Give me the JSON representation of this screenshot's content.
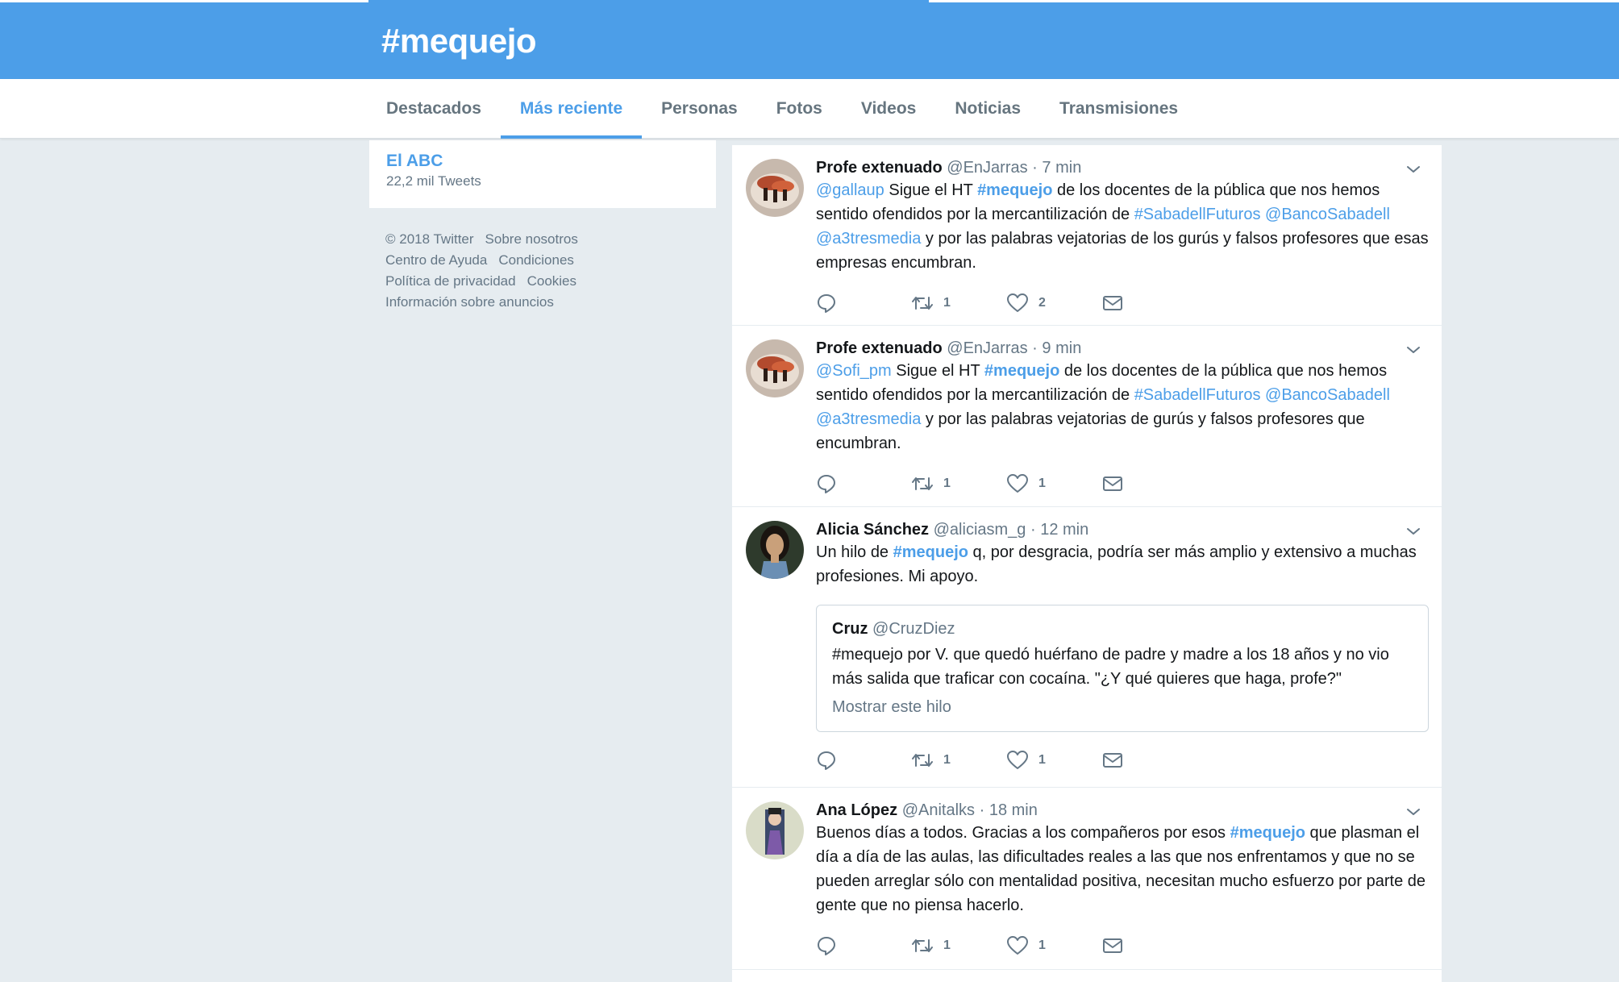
{
  "header": {
    "title": "#mequejo"
  },
  "tabs": [
    {
      "label": "Destacados"
    },
    {
      "label": "Más reciente"
    },
    {
      "label": "Personas"
    },
    {
      "label": "Fotos"
    },
    {
      "label": "Videos"
    },
    {
      "label": "Noticias"
    },
    {
      "label": "Transmisiones"
    }
  ],
  "active_tab": "Más reciente",
  "trend": {
    "name": "El ABC",
    "count": "22,2 mil Tweets"
  },
  "footer": {
    "row1": [
      "© 2018 Twitter",
      "Sobre nosotros"
    ],
    "row2": [
      "Centro de Ayuda",
      "Condiciones"
    ],
    "row3": [
      "Política de privacidad",
      "Cookies"
    ],
    "row4": [
      "Información sobre anuncios"
    ]
  },
  "tweets": [
    {
      "name": "Profe extenuado",
      "handle": "@EnJarras",
      "sep": "·",
      "time": "7 min",
      "text": {
        "t1": "@gallaup",
        "t2": " Sigue el HT ",
        "t3": "#mequejo",
        "t4": " de los docentes de la pública que nos hemos sentido ofendidos por la mercantilización de ",
        "t5": "#SabadellFuturos",
        "t6": " ",
        "t7": "@BancoSabadell",
        "t8": " ",
        "t9": "@a3tresmedia",
        "t10": " y por las palabras vejatorias de los gurús y falsos profesores que esas empresas encumbran."
      },
      "retweets": "1",
      "likes": "2"
    },
    {
      "name": "Profe extenuado",
      "handle": "@EnJarras",
      "sep": "·",
      "time": "9 min",
      "text": {
        "t1": "@Sofi_pm",
        "t2": " Sigue el HT ",
        "t3": "#mequejo",
        "t4": " de los docentes de la pública que nos hemos sentido ofendidos por la mercantilización de ",
        "t5": "#SabadellFuturos",
        "t6": " ",
        "t7": "@BancoSabadell",
        "t8": " ",
        "t9": "@a3tresmedia",
        "t10": " y por las palabras vejatorias de gurús y falsos profesores que encumbran."
      },
      "retweets": "1",
      "likes": "1"
    },
    {
      "name": "Alicia Sánchez",
      "handle": "@aliciasm_g",
      "sep": "·",
      "time": "12 min",
      "text": {
        "t1": "Un hilo de ",
        "t2": "#mequejo",
        "t3": " q, por desgracia, podría ser más amplio y extensivo a muchas profesiones. Mi apoyo."
      },
      "quote": {
        "name": "Cruz",
        "handle": "@CruzDiez",
        "text": "#mequejo por V. que quedó huérfano de padre y madre a los 18 años y no vio más salida que traficar con cocaína. \"¿Y qué quieres que haga, profe?\"",
        "more": "Mostrar este hilo"
      },
      "retweets": "1",
      "likes": "1"
    },
    {
      "name": "Ana López",
      "handle": "@Anitalks",
      "sep": "·",
      "time": "18 min",
      "text": {
        "t1": "Buenos días a todos. Gracias a los compañeros por esos ",
        "t2": "#mequejo",
        "t3": " que plasman el día a día de las aulas, las dificultades reales a las que nos enfrentamos y que no se pueden arreglar sólo con mentalidad positiva, necesitan mucho esfuerzo por parte de gente que no piensa hacerlo."
      },
      "retweets": "1",
      "likes": "1"
    }
  ],
  "colors": {
    "brand": "#4c9ee8",
    "background": "#e6ecf0",
    "muted": "#657786"
  },
  "icons": [
    "chevron-down-icon",
    "reply-icon",
    "retweet-icon",
    "heart-icon",
    "message-icon"
  ]
}
